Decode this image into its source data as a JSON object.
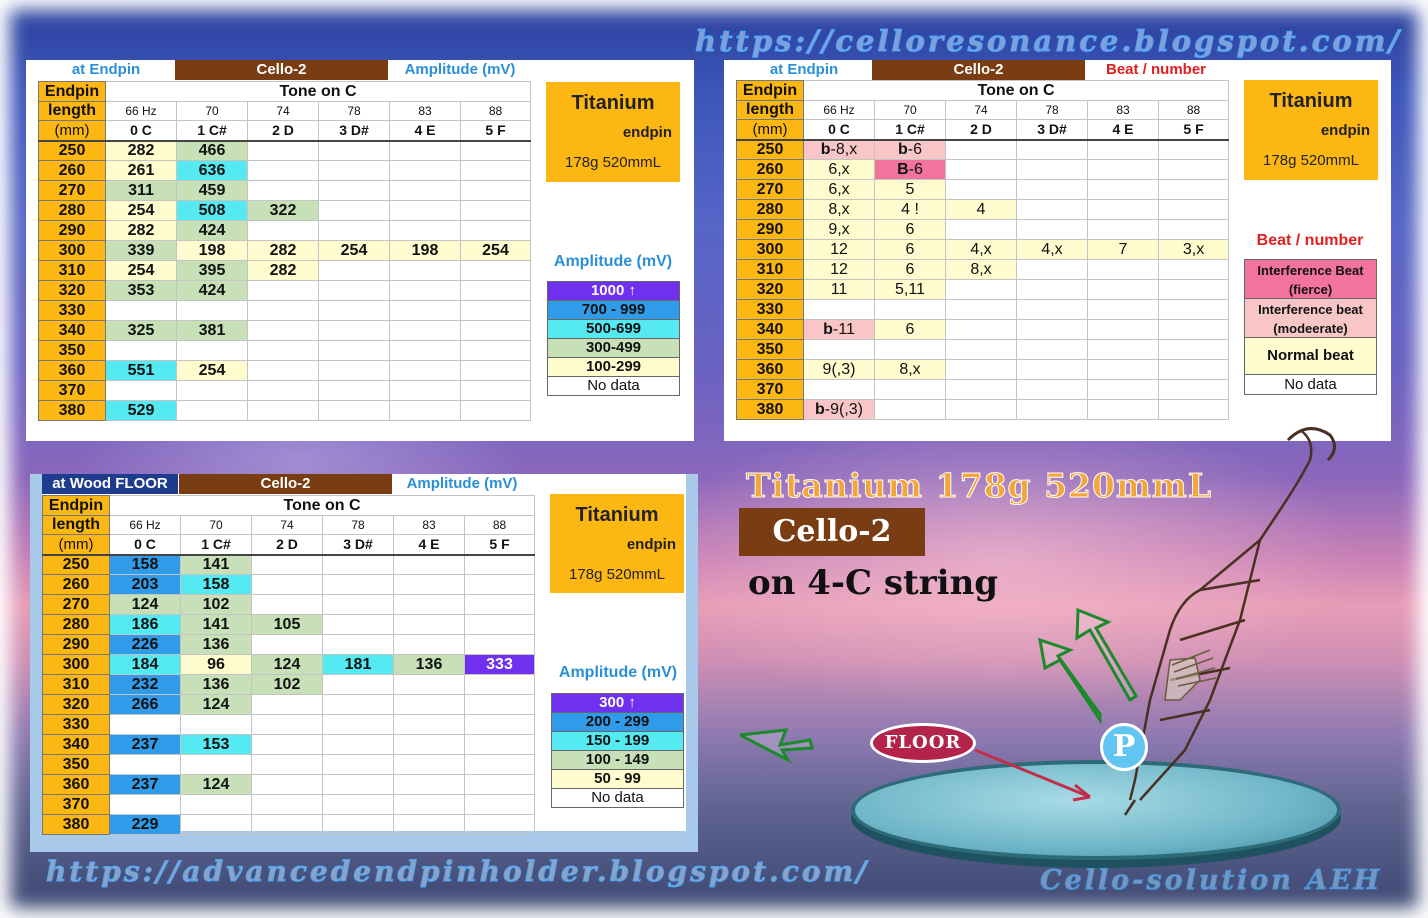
{
  "urls": {
    "top": "https://celloresonance.blogspot.com/",
    "bottom": "https://advancedendpinholder.blogspot.com/",
    "signature": "Cello-solution AEH"
  },
  "columns": {
    "hz": [
      "66 Hz",
      "70",
      "74",
      "78",
      "83",
      "88"
    ],
    "tones": [
      "0 C",
      "1 C#",
      "2 D",
      "3 D#",
      "4 E",
      "5 F"
    ],
    "tone_header": "Tone   on C",
    "rowhead": [
      "Endpin",
      "length",
      "(mm)"
    ],
    "lengths": [
      "250",
      "260",
      "270",
      "280",
      "290",
      "300",
      "310",
      "320",
      "330",
      "340",
      "350",
      "360",
      "370",
      "380"
    ]
  },
  "badge": {
    "title": "Titanium",
    "sub": "endpin",
    "spec": "178g  520mmL"
  },
  "table_endpin": {
    "h_left": "at Endpin",
    "h_mid": "Cello-2",
    "h_right": "Amplitude (mV)",
    "rows": [
      [
        [
          "282",
          "yellow"
        ],
        [
          "466",
          "green"
        ],
        [
          "",
          ""
        ],
        [
          "",
          ""
        ],
        [
          "",
          ""
        ],
        [
          "",
          ""
        ]
      ],
      [
        [
          "261",
          "yellow"
        ],
        [
          "636",
          "cyan"
        ],
        [
          "",
          ""
        ],
        [
          "",
          ""
        ],
        [
          "",
          ""
        ],
        [
          "",
          ""
        ]
      ],
      [
        [
          "311",
          "green"
        ],
        [
          "459",
          "green"
        ],
        [
          "",
          ""
        ],
        [
          "",
          ""
        ],
        [
          "",
          ""
        ],
        [
          "",
          ""
        ]
      ],
      [
        [
          "254",
          "yellow"
        ],
        [
          "508",
          "cyan"
        ],
        [
          "322",
          "green"
        ],
        [
          "",
          ""
        ],
        [
          "",
          ""
        ],
        [
          "",
          ""
        ]
      ],
      [
        [
          "282",
          "yellow"
        ],
        [
          "424",
          "green"
        ],
        [
          "",
          ""
        ],
        [
          "",
          ""
        ],
        [
          "",
          ""
        ],
        [
          "",
          ""
        ]
      ],
      [
        [
          "339",
          "green"
        ],
        [
          "198",
          "yellow"
        ],
        [
          "282",
          "yellow"
        ],
        [
          "254",
          "yellow"
        ],
        [
          "198",
          "yellow"
        ],
        [
          "254",
          "yellow"
        ]
      ],
      [
        [
          "254",
          "yellow"
        ],
        [
          "395",
          "green"
        ],
        [
          "282",
          "yellow"
        ],
        [
          "",
          ""
        ],
        [
          "",
          ""
        ],
        [
          "",
          ""
        ]
      ],
      [
        [
          "353",
          "green"
        ],
        [
          "424",
          "green"
        ],
        [
          "",
          ""
        ],
        [
          "",
          ""
        ],
        [
          "",
          ""
        ],
        [
          "",
          ""
        ]
      ],
      [
        [
          "",
          ""
        ],
        [
          "",
          ""
        ],
        [
          "",
          ""
        ],
        [
          "",
          ""
        ],
        [
          "",
          ""
        ],
        [
          "",
          ""
        ]
      ],
      [
        [
          "325",
          "green"
        ],
        [
          "381",
          "green"
        ],
        [
          "",
          ""
        ],
        [
          "",
          ""
        ],
        [
          "",
          ""
        ],
        [
          "",
          ""
        ]
      ],
      [
        [
          "",
          ""
        ],
        [
          "",
          ""
        ],
        [
          "",
          ""
        ],
        [
          "",
          ""
        ],
        [
          "",
          ""
        ],
        [
          "",
          ""
        ]
      ],
      [
        [
          "551",
          "cyan"
        ],
        [
          "254",
          "yellow"
        ],
        [
          "",
          ""
        ],
        [
          "",
          ""
        ],
        [
          "",
          ""
        ],
        [
          "",
          ""
        ]
      ],
      [
        [
          "",
          ""
        ],
        [
          "",
          ""
        ],
        [
          "",
          ""
        ],
        [
          "",
          ""
        ],
        [
          "",
          ""
        ],
        [
          "",
          ""
        ]
      ],
      [
        [
          "529",
          "cyan"
        ],
        [
          "",
          ""
        ],
        [
          "",
          ""
        ],
        [
          "",
          ""
        ],
        [
          "",
          ""
        ],
        [
          "",
          ""
        ]
      ]
    ],
    "legend_title": "Amplitude (mV)",
    "legend": [
      {
        "label": "1000 ↑",
        "color": "purple"
      },
      {
        "label": "700 - 999",
        "color": "blue"
      },
      {
        "label": "500-699",
        "color": "cyan"
      },
      {
        "label": "300-499",
        "color": "green"
      },
      {
        "label": "100-299",
        "color": "yellow"
      },
      {
        "label": "No data",
        "color": ""
      }
    ]
  },
  "table_beat": {
    "h_left": "at Endpin",
    "h_mid": "Cello-2",
    "h_right": "Beat / number",
    "rows": [
      [
        [
          "b-8,x",
          "pink"
        ],
        [
          "b-6",
          "pink"
        ],
        [
          "",
          ""
        ],
        [
          "",
          ""
        ],
        [
          "",
          ""
        ],
        [
          "",
          ""
        ]
      ],
      [
        [
          "6,x",
          "yellow"
        ],
        [
          "B-6",
          "hotpink"
        ],
        [
          "",
          ""
        ],
        [
          "",
          ""
        ],
        [
          "",
          ""
        ],
        [
          "",
          ""
        ]
      ],
      [
        [
          "6,x",
          "yellow"
        ],
        [
          "5",
          "yellow"
        ],
        [
          "",
          ""
        ],
        [
          "",
          ""
        ],
        [
          "",
          ""
        ],
        [
          "",
          ""
        ]
      ],
      [
        [
          "8,x",
          "yellow"
        ],
        [
          "4 !",
          "yellow"
        ],
        [
          "4",
          "yellow"
        ],
        [
          "",
          ""
        ],
        [
          "",
          ""
        ],
        [
          "",
          ""
        ]
      ],
      [
        [
          "9,x",
          "yellow"
        ],
        [
          "6",
          "yellow"
        ],
        [
          "",
          ""
        ],
        [
          "",
          ""
        ],
        [
          "",
          ""
        ],
        [
          "",
          ""
        ]
      ],
      [
        [
          "12",
          "yellow"
        ],
        [
          "6",
          "yellow"
        ],
        [
          "4,x",
          "yellow"
        ],
        [
          "4,x",
          "yellow"
        ],
        [
          "7",
          "yellow"
        ],
        [
          "3,x",
          "yellow"
        ]
      ],
      [
        [
          "12",
          "yellow"
        ],
        [
          "6",
          "yellow"
        ],
        [
          "8,x",
          "yellow"
        ],
        [
          "",
          ""
        ],
        [
          "",
          ""
        ],
        [
          "",
          ""
        ]
      ],
      [
        [
          "11",
          "yellow"
        ],
        [
          "5,11",
          "yellow"
        ],
        [
          "",
          ""
        ],
        [
          "",
          ""
        ],
        [
          "",
          ""
        ],
        [
          "",
          ""
        ]
      ],
      [
        [
          "",
          ""
        ],
        [
          "",
          ""
        ],
        [
          "",
          ""
        ],
        [
          "",
          ""
        ],
        [
          "",
          ""
        ],
        [
          "",
          ""
        ]
      ],
      [
        [
          "b-11",
          "pink"
        ],
        [
          "6",
          "yellow"
        ],
        [
          "",
          ""
        ],
        [
          "",
          ""
        ],
        [
          "",
          ""
        ],
        [
          "",
          ""
        ]
      ],
      [
        [
          "",
          ""
        ],
        [
          "",
          ""
        ],
        [
          "",
          ""
        ],
        [
          "",
          ""
        ],
        [
          "",
          ""
        ],
        [
          "",
          ""
        ]
      ],
      [
        [
          "9(,3)",
          "yellow"
        ],
        [
          "8,x",
          "yellow"
        ],
        [
          "",
          ""
        ],
        [
          "",
          ""
        ],
        [
          "",
          ""
        ],
        [
          "",
          ""
        ]
      ],
      [
        [
          "",
          ""
        ],
        [
          "",
          ""
        ],
        [
          "",
          ""
        ],
        [
          "",
          ""
        ],
        [
          "",
          ""
        ],
        [
          "",
          ""
        ]
      ],
      [
        [
          "b-9(,3)",
          "pink"
        ],
        [
          "",
          ""
        ],
        [
          "",
          ""
        ],
        [
          "",
          ""
        ],
        [
          "",
          ""
        ],
        [
          "",
          ""
        ]
      ]
    ],
    "legend_title": "Beat / number",
    "legend": [
      {
        "label": "Interference Beat (fierce)",
        "color": "hotpink"
      },
      {
        "label": "Interference beat (modeerate)",
        "color": "pink"
      },
      {
        "label": "Normal  beat",
        "color": "yellow"
      },
      {
        "label": "No data",
        "color": ""
      }
    ]
  },
  "table_floor": {
    "h_left": "at Wood FLOOR",
    "h_mid": "Cello-2",
    "h_right": "Amplitude (mV)",
    "rows": [
      [
        [
          "158",
          "blue"
        ],
        [
          "141",
          "green"
        ],
        [
          "",
          ""
        ],
        [
          "",
          ""
        ],
        [
          "",
          ""
        ],
        [
          "",
          ""
        ]
      ],
      [
        [
          "203",
          "blue"
        ],
        [
          "158",
          "cyan"
        ],
        [
          "",
          ""
        ],
        [
          "",
          ""
        ],
        [
          "",
          ""
        ],
        [
          "",
          ""
        ]
      ],
      [
        [
          "124",
          "green"
        ],
        [
          "102",
          "green"
        ],
        [
          "",
          ""
        ],
        [
          "",
          ""
        ],
        [
          "",
          ""
        ],
        [
          "",
          ""
        ]
      ],
      [
        [
          "186",
          "cyan"
        ],
        [
          "141",
          "green"
        ],
        [
          "105",
          "green"
        ],
        [
          "",
          ""
        ],
        [
          "",
          ""
        ],
        [
          "",
          ""
        ]
      ],
      [
        [
          "226",
          "blue"
        ],
        [
          "136",
          "green"
        ],
        [
          "",
          ""
        ],
        [
          "",
          ""
        ],
        [
          "",
          ""
        ],
        [
          "",
          ""
        ]
      ],
      [
        [
          "184",
          "cyan"
        ],
        [
          "96",
          "yellow"
        ],
        [
          "124",
          "green"
        ],
        [
          "181",
          "cyan"
        ],
        [
          "136",
          "green"
        ],
        [
          "333",
          "purple"
        ]
      ],
      [
        [
          "232",
          "blue"
        ],
        [
          "136",
          "green"
        ],
        [
          "102",
          "green"
        ],
        [
          "",
          ""
        ],
        [
          "",
          ""
        ],
        [
          "",
          ""
        ]
      ],
      [
        [
          "266",
          "blue"
        ],
        [
          "124",
          "green"
        ],
        [
          "",
          ""
        ],
        [
          "",
          ""
        ],
        [
          "",
          ""
        ],
        [
          "",
          ""
        ]
      ],
      [
        [
          "",
          ""
        ],
        [
          "",
          ""
        ],
        [
          "",
          ""
        ],
        [
          "",
          ""
        ],
        [
          "",
          ""
        ],
        [
          "",
          ""
        ]
      ],
      [
        [
          "237",
          "blue"
        ],
        [
          "153",
          "cyan"
        ],
        [
          "",
          ""
        ],
        [
          "",
          ""
        ],
        [
          "",
          ""
        ],
        [
          "",
          ""
        ]
      ],
      [
        [
          "",
          ""
        ],
        [
          "",
          ""
        ],
        [
          "",
          ""
        ],
        [
          "",
          ""
        ],
        [
          "",
          ""
        ],
        [
          "",
          ""
        ]
      ],
      [
        [
          "237",
          "blue"
        ],
        [
          "124",
          "green"
        ],
        [
          "",
          ""
        ],
        [
          "",
          ""
        ],
        [
          "",
          ""
        ],
        [
          "",
          ""
        ]
      ],
      [
        [
          "",
          ""
        ],
        [
          "",
          ""
        ],
        [
          "",
          ""
        ],
        [
          "",
          ""
        ],
        [
          "",
          ""
        ],
        [
          "",
          ""
        ]
      ],
      [
        [
          "229",
          "blue"
        ],
        [
          "",
          ""
        ],
        [
          "",
          ""
        ],
        [
          "",
          ""
        ],
        [
          "",
          ""
        ],
        [
          "",
          ""
        ]
      ]
    ],
    "legend_title": "Amplitude (mV)",
    "legend": [
      {
        "label": "300 ↑",
        "color": "purple"
      },
      {
        "label": "200 - 299",
        "color": "blue"
      },
      {
        "label": "150 - 199",
        "color": "cyan"
      },
      {
        "label": "100 - 149",
        "color": "green"
      },
      {
        "label": "50 - 99",
        "color": "yellow"
      },
      {
        "label": "No data",
        "color": ""
      }
    ]
  },
  "poster": {
    "title": "Titanium  178g  520mmL",
    "cello": "Cello-2",
    "string": "on 4-C string",
    "floor_label": "FLOOR",
    "p_label": "P"
  }
}
